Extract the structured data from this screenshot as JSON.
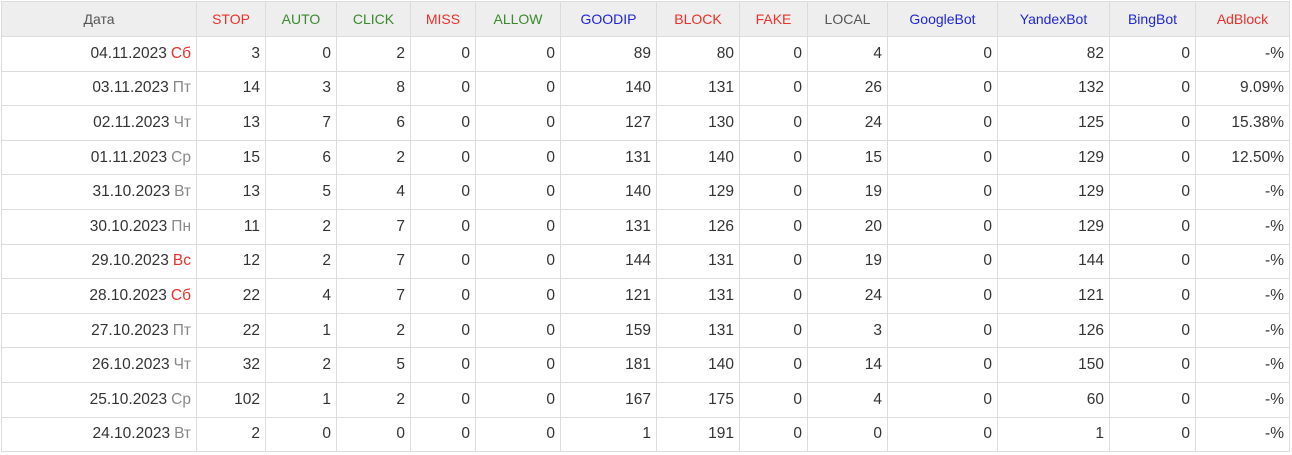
{
  "columns": [
    {
      "key": "date",
      "label": "Дата",
      "color": "#555555"
    },
    {
      "key": "stop",
      "label": "STOP",
      "color": "#e8312a"
    },
    {
      "key": "auto",
      "label": "AUTO",
      "color": "#3a8a2c"
    },
    {
      "key": "click",
      "label": "CLICK",
      "color": "#3a8a2c"
    },
    {
      "key": "miss",
      "label": "MISS",
      "color": "#e8312a"
    },
    {
      "key": "allow",
      "label": "ALLOW",
      "color": "#3a8a2c"
    },
    {
      "key": "goodip",
      "label": "GOODIP",
      "color": "#1f26d6"
    },
    {
      "key": "block",
      "label": "BLOCK",
      "color": "#e8312a"
    },
    {
      "key": "fake",
      "label": "FAKE",
      "color": "#e8312a"
    },
    {
      "key": "local",
      "label": "LOCAL",
      "color": "#555555"
    },
    {
      "key": "googlebot",
      "label": "GoogleBot",
      "color": "#1f26d6"
    },
    {
      "key": "yandexbot",
      "label": "YandexBot",
      "color": "#1f26d6"
    },
    {
      "key": "bingbot",
      "label": "BingBot",
      "color": "#1f26d6"
    },
    {
      "key": "adblock",
      "label": "AdBlock",
      "color": "#e8312a"
    }
  ],
  "rows": [
    {
      "date": "04.11.2023",
      "day": "Сб",
      "weekend": true,
      "stop": "3",
      "auto": "0",
      "click": "2",
      "miss": "0",
      "allow": "0",
      "goodip": "89",
      "block": "80",
      "fake": "0",
      "local": "4",
      "googlebot": "0",
      "yandexbot": "82",
      "bingbot": "0",
      "adblock": "-%"
    },
    {
      "date": "03.11.2023",
      "day": "Пт",
      "weekend": false,
      "stop": "14",
      "auto": "3",
      "click": "8",
      "miss": "0",
      "allow": "0",
      "goodip": "140",
      "block": "131",
      "fake": "0",
      "local": "26",
      "googlebot": "0",
      "yandexbot": "132",
      "bingbot": "0",
      "adblock": "9.09%"
    },
    {
      "date": "02.11.2023",
      "day": "Чт",
      "weekend": false,
      "stop": "13",
      "auto": "7",
      "click": "6",
      "miss": "0",
      "allow": "0",
      "goodip": "127",
      "block": "130",
      "fake": "0",
      "local": "24",
      "googlebot": "0",
      "yandexbot": "125",
      "bingbot": "0",
      "adblock": "15.38%"
    },
    {
      "date": "01.11.2023",
      "day": "Ср",
      "weekend": false,
      "stop": "15",
      "auto": "6",
      "click": "2",
      "miss": "0",
      "allow": "0",
      "goodip": "131",
      "block": "140",
      "fake": "0",
      "local": "15",
      "googlebot": "0",
      "yandexbot": "129",
      "bingbot": "0",
      "adblock": "12.50%"
    },
    {
      "date": "31.10.2023",
      "day": "Вт",
      "weekend": false,
      "stop": "13",
      "auto": "5",
      "click": "4",
      "miss": "0",
      "allow": "0",
      "goodip": "140",
      "block": "129",
      "fake": "0",
      "local": "19",
      "googlebot": "0",
      "yandexbot": "129",
      "bingbot": "0",
      "adblock": "-%"
    },
    {
      "date": "30.10.2023",
      "day": "Пн",
      "weekend": false,
      "stop": "11",
      "auto": "2",
      "click": "7",
      "miss": "0",
      "allow": "0",
      "goodip": "131",
      "block": "126",
      "fake": "0",
      "local": "20",
      "googlebot": "0",
      "yandexbot": "129",
      "bingbot": "0",
      "adblock": "-%"
    },
    {
      "date": "29.10.2023",
      "day": "Вс",
      "weekend": true,
      "stop": "12",
      "auto": "2",
      "click": "7",
      "miss": "0",
      "allow": "0",
      "goodip": "144",
      "block": "131",
      "fake": "0",
      "local": "19",
      "googlebot": "0",
      "yandexbot": "144",
      "bingbot": "0",
      "adblock": "-%"
    },
    {
      "date": "28.10.2023",
      "day": "Сб",
      "weekend": true,
      "stop": "22",
      "auto": "4",
      "click": "7",
      "miss": "0",
      "allow": "0",
      "goodip": "121",
      "block": "131",
      "fake": "0",
      "local": "24",
      "googlebot": "0",
      "yandexbot": "121",
      "bingbot": "0",
      "adblock": "-%"
    },
    {
      "date": "27.10.2023",
      "day": "Пт",
      "weekend": false,
      "stop": "22",
      "auto": "1",
      "click": "2",
      "miss": "0",
      "allow": "0",
      "goodip": "159",
      "block": "131",
      "fake": "0",
      "local": "3",
      "googlebot": "0",
      "yandexbot": "126",
      "bingbot": "0",
      "adblock": "-%"
    },
    {
      "date": "26.10.2023",
      "day": "Чт",
      "weekend": false,
      "stop": "32",
      "auto": "2",
      "click": "5",
      "miss": "0",
      "allow": "0",
      "goodip": "181",
      "block": "140",
      "fake": "0",
      "local": "14",
      "googlebot": "0",
      "yandexbot": "150",
      "bingbot": "0",
      "adblock": "-%"
    },
    {
      "date": "25.10.2023",
      "day": "Ср",
      "weekend": false,
      "stop": "102",
      "auto": "1",
      "click": "2",
      "miss": "0",
      "allow": "0",
      "goodip": "167",
      "block": "175",
      "fake": "0",
      "local": "4",
      "googlebot": "0",
      "yandexbot": "60",
      "bingbot": "0",
      "adblock": "-%"
    },
    {
      "date": "24.10.2023",
      "day": "Вт",
      "weekend": false,
      "stop": "2",
      "auto": "0",
      "click": "0",
      "miss": "0",
      "allow": "0",
      "goodip": "1",
      "block": "191",
      "fake": "0",
      "local": "0",
      "googlebot": "0",
      "yandexbot": "1",
      "bingbot": "0",
      "adblock": "-%"
    }
  ]
}
